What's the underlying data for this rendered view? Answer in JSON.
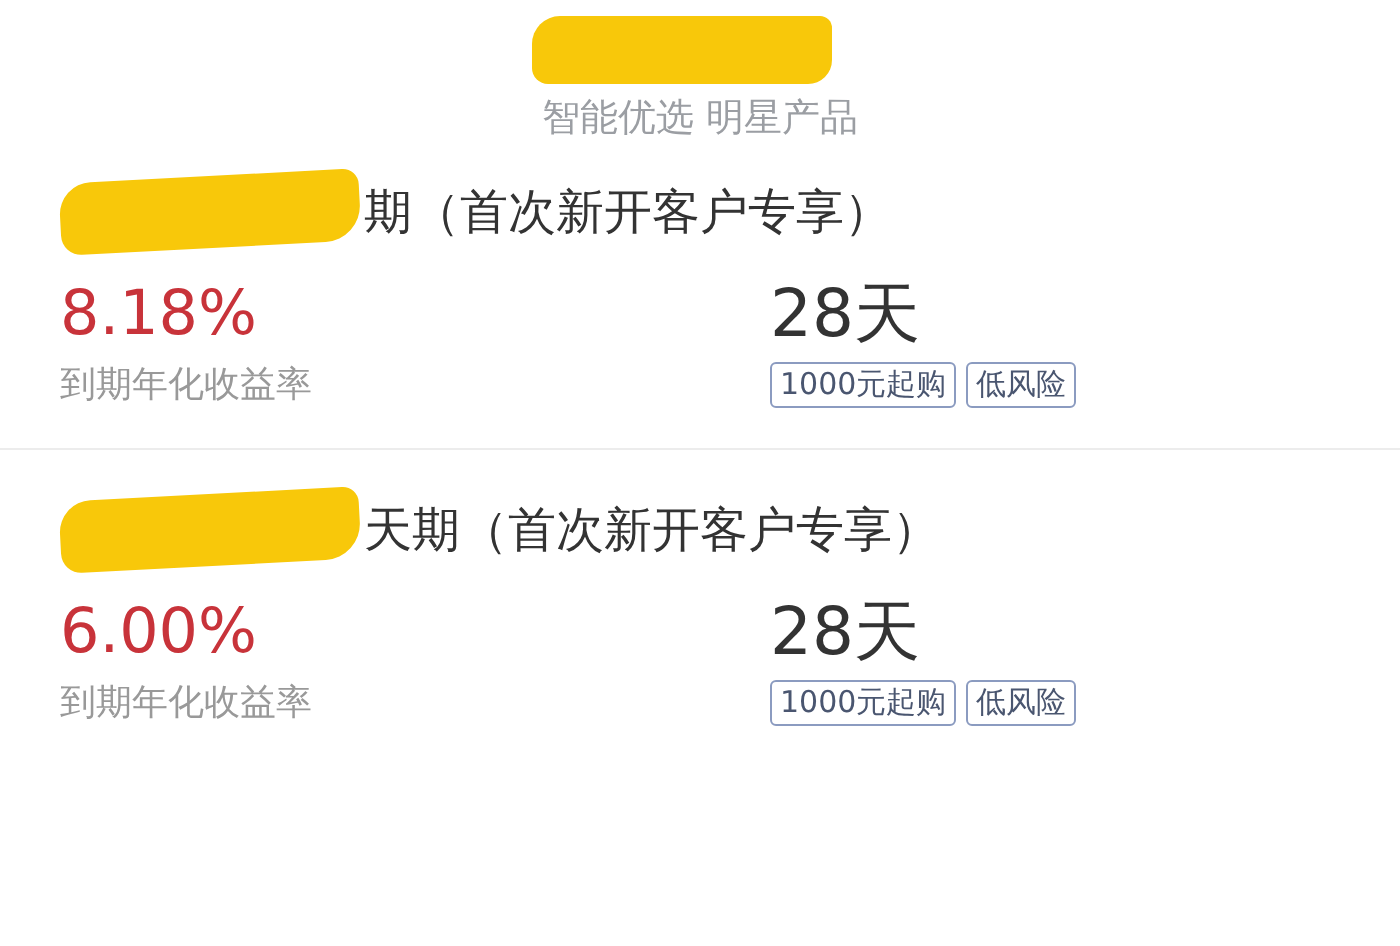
{
  "header": {
    "subtitle": "智能优选 明星产品"
  },
  "products": [
    {
      "title": "期（首次新开客户专享）",
      "rate": "8.18%",
      "rate_label": "到期年化收益率",
      "term": "28天",
      "tags": [
        "1000元起购",
        "低风险"
      ]
    },
    {
      "title": "天期（首次新开客户专享）",
      "rate": "6.00%",
      "rate_label": "到期年化收益率",
      "term": "28天",
      "tags": [
        "1000元起购",
        "低风险"
      ]
    }
  ]
}
